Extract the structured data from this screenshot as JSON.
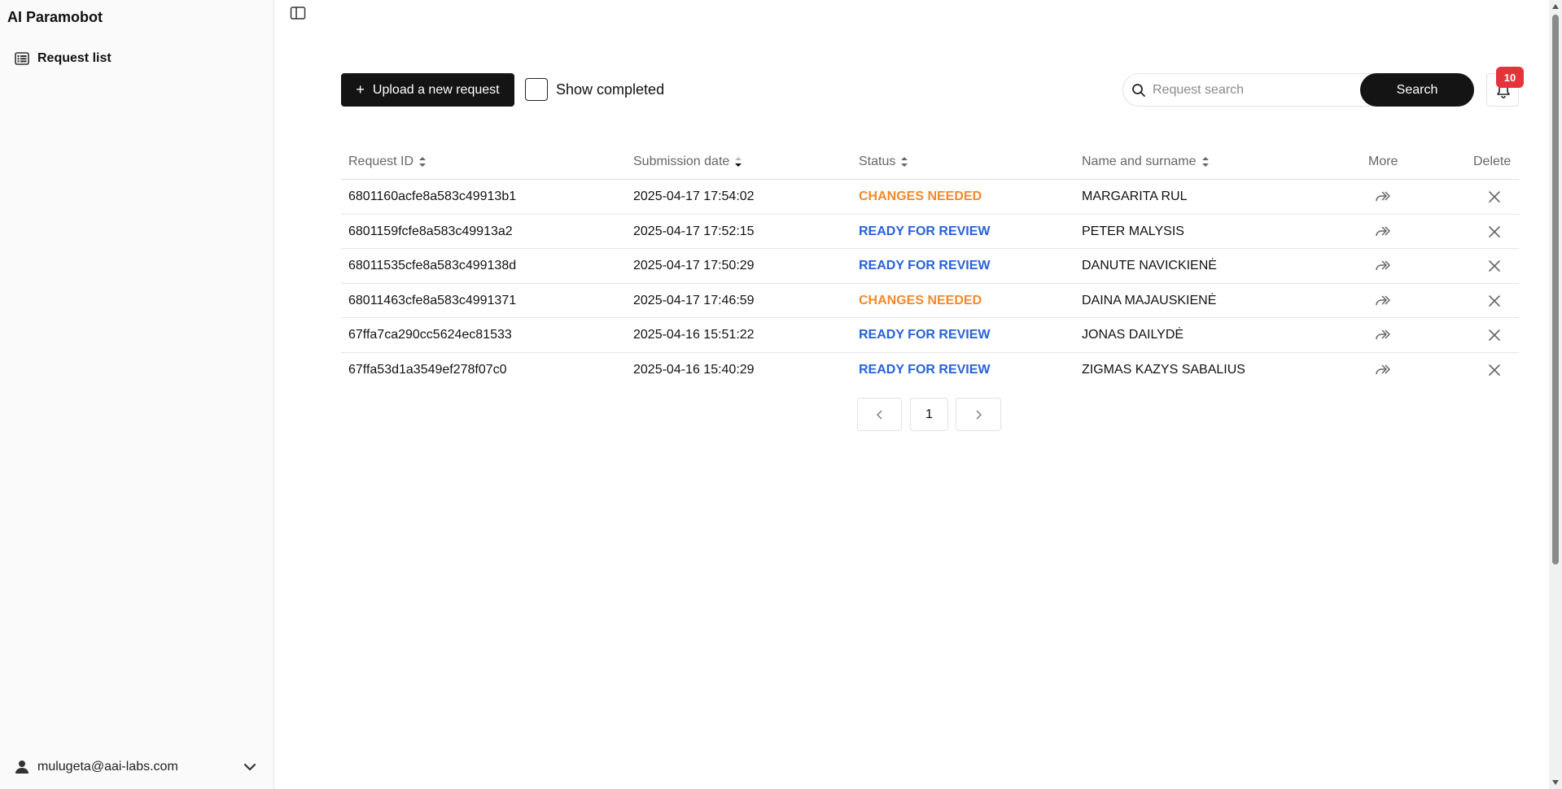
{
  "app": {
    "title": "AI Paramobot"
  },
  "sidebar": {
    "items": [
      {
        "label": "Request list",
        "icon": "list-icon"
      }
    ],
    "user": {
      "email": "mulugeta@aai-labs.com",
      "icon": "user-icon"
    }
  },
  "toolbar": {
    "upload_label": "Upload a new request",
    "show_completed_label": "Show completed",
    "show_completed_checked": false,
    "search_placeholder": "Request search",
    "search_value": "",
    "search_label": "Search",
    "notification_count": "10"
  },
  "table": {
    "columns": [
      "Request ID",
      "Submission date",
      "Status",
      "Name and surname",
      "More",
      "Delete"
    ],
    "rows": [
      {
        "id": "6801160acfe8a583c49913b1",
        "date": "2025-04-17 17:54:02",
        "status": "CHANGES NEEDED",
        "status_type": "changes",
        "name": "MARGARITA RUL"
      },
      {
        "id": "6801159fcfe8a583c49913a2",
        "date": "2025-04-17 17:52:15",
        "status": "READY FOR REVIEW",
        "status_type": "ready",
        "name": "PETER MALYSIS"
      },
      {
        "id": "68011535cfe8a583c499138d",
        "date": "2025-04-17 17:50:29",
        "status": "READY FOR REVIEW",
        "status_type": "ready",
        "name": "DANUTE NAVICKIENĖ"
      },
      {
        "id": "68011463cfe8a583c4991371",
        "date": "2025-04-17 17:46:59",
        "status": "CHANGES NEEDED",
        "status_type": "changes",
        "name": "DAINA MAJAUSKIENĖ"
      },
      {
        "id": "67ffa7ca290cc5624ec81533",
        "date": "2025-04-16 15:51:22",
        "status": "READY FOR REVIEW",
        "status_type": "ready",
        "name": "JONAS DAILYDĖ"
      },
      {
        "id": "67ffa53d1a3549ef278f07c0",
        "date": "2025-04-16 15:40:29",
        "status": "READY FOR REVIEW",
        "status_type": "ready",
        "name": "ZIGMAS KAZYS SABALIUS"
      }
    ]
  },
  "pagination": {
    "current_page": "1"
  },
  "colors": {
    "changes": "#f2892b",
    "ready": "#2862d9",
    "badge": "#e5323b",
    "primary": "#141414"
  }
}
